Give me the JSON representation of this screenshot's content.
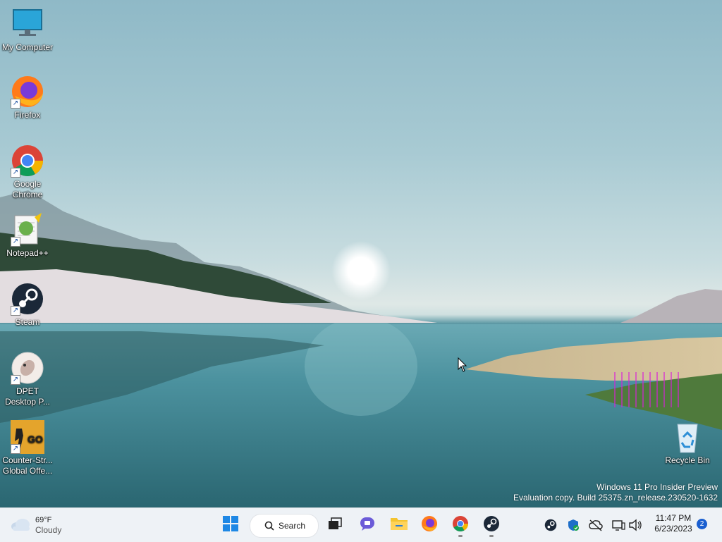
{
  "desktop": {
    "icons": [
      {
        "label": "My Computer",
        "icon": "monitor-icon"
      },
      {
        "label": "Firefox",
        "icon": "firefox-icon"
      },
      {
        "label": "Google Chrome",
        "icon": "chrome-icon"
      },
      {
        "label": "Notepad++",
        "icon": "notepadpp-icon"
      },
      {
        "label": "Steam",
        "icon": "steam-icon"
      },
      {
        "label": "DPET Desktop P...",
        "icon": "dpet-icon"
      },
      {
        "label": "Counter-Str... Global Offe...",
        "icon": "csgo-icon"
      },
      {
        "label": "Recycle Bin",
        "icon": "recycle-bin-icon"
      }
    ],
    "watermark": {
      "line1": "Windows 11 Pro Insider Preview",
      "line2": "Evaluation copy. Build 25375.zn_release.230520-1632"
    }
  },
  "taskbar": {
    "weather": {
      "temp": "69°F",
      "condition": "Cloudy",
      "icon": "cloud-icon"
    },
    "search_label": "Search",
    "pinned": [
      {
        "name": "start",
        "icon": "windows-start-icon"
      },
      {
        "name": "task-view",
        "icon": "task-view-icon"
      },
      {
        "name": "chat",
        "icon": "teams-chat-icon"
      },
      {
        "name": "file-explorer",
        "icon": "folder-icon"
      },
      {
        "name": "firefox",
        "icon": "firefox-icon"
      },
      {
        "name": "chrome",
        "icon": "chrome-icon",
        "running": true
      },
      {
        "name": "steam",
        "icon": "steam-icon",
        "running": true
      }
    ],
    "tray": [
      "steam-tray-icon",
      "defender-shield-icon",
      "cloud-offline-icon",
      "network-icon",
      "volume-icon"
    ],
    "clock": {
      "time": "11:47 PM",
      "date": "6/23/2023"
    },
    "notification_count": "2"
  },
  "colors": {
    "taskbar_bg": "#eef2f6",
    "accent": "#1a5fd0"
  }
}
